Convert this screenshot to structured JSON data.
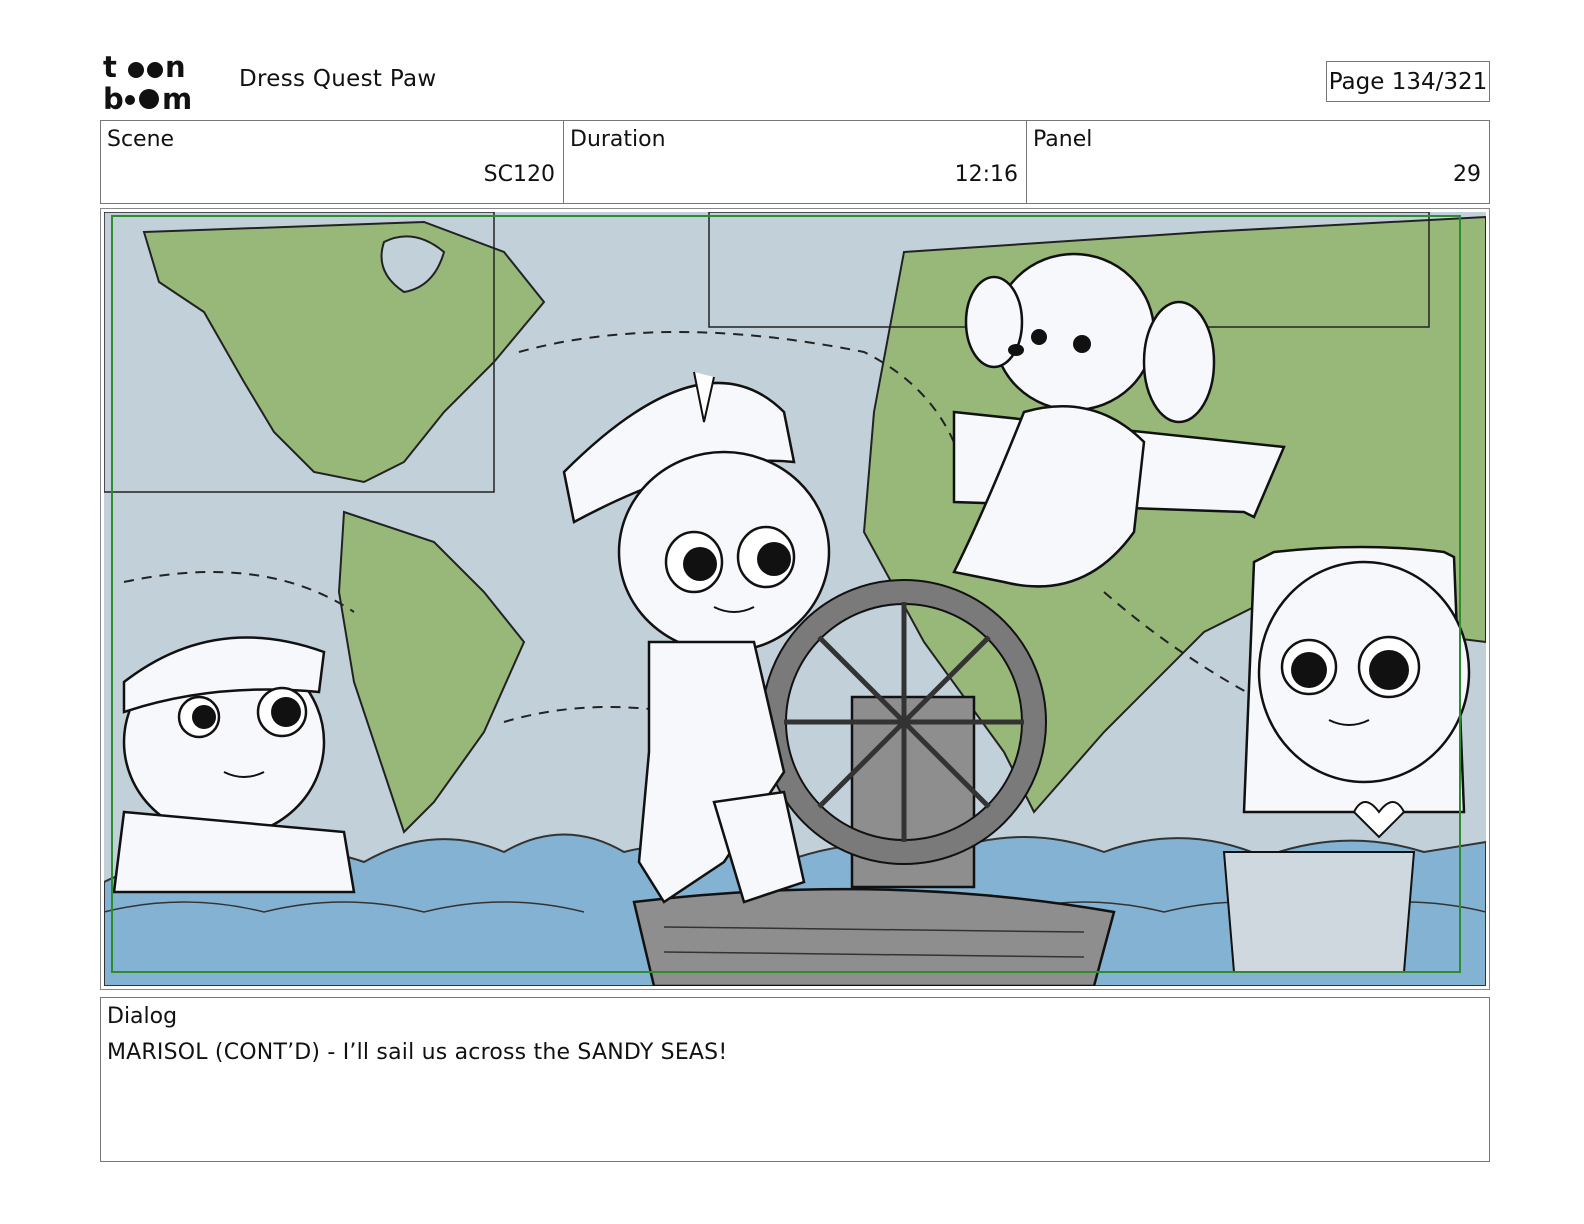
{
  "header": {
    "logo_text_line1": "toon",
    "logo_text_line2": "boom",
    "project_title": "Dress Quest Paw",
    "page_indicator": "Page 134/321"
  },
  "info": {
    "scene_label": "Scene",
    "scene_value": "SC120",
    "duration_label": "Duration",
    "duration_value": "12:16",
    "panel_label": "Panel",
    "panel_value": "29"
  },
  "dialog": {
    "label": "Dialog",
    "text": "MARISOL (CONT’D) - I’ll sail us across the SANDY SEAS!"
  },
  "colors": {
    "map_ocean": "#c2d0da",
    "map_land": "#98b87a",
    "water": "#84b2d2",
    "boat": "#8a8a8a",
    "safe_frame": "#2e8b2e"
  }
}
